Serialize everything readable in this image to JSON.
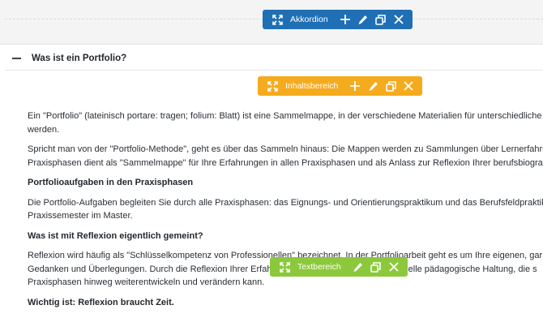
{
  "toolbars": {
    "accordion": {
      "label": "Akkordion",
      "color": "#1f6fb5"
    },
    "content_area": {
      "label": "Inhaltsbereich",
      "color": "#f5ab1e"
    },
    "text_area": {
      "label": "Textbereich",
      "color": "#8cc83c"
    }
  },
  "accordion": {
    "title": "Was ist ein Portfolio?"
  },
  "content": {
    "p1": [
      "Ein \"Portfolio\" (lateinisch portare: tragen; folium: Blatt) ist eine Sammelmappe, in der verschiedene Materialien für unterschiedliche",
      "werden."
    ],
    "p2": [
      "Spricht man von der \"Portfolio-Methode\", geht es über das Sammeln hinaus: Die Mappen werden zu Sammlungen über Lernerfahrun",
      "Praxisphasen dient als \"Sammelmappe\" für Ihre Erfahrungen in allen Praxisphasen und als Anlass zur Reflexion Ihrer berufsbiografis"
    ],
    "h1": "Portfolioaufgaben in den Praxisphasen",
    "p3": [
      "Die Portfolio-Aufgaben begleiten Sie durch alle Praxisphasen: das Eignungs- und Orientierungspraktikum und das Berufsfeldpraktik",
      "Praxissemester im Master."
    ],
    "h2": "Was ist mit Reflexion eigentlich gemeint?",
    "p4": [
      "Reflexion wird häufig als \"Schlüsselkompetenz von Professionellen\" bezeichnet. In der Portfolioarbeit geht es um Ihre eigenen, gar",
      "Gedanken und Überlegungen. Durch die Reflexion Ihrer Erfahrungen können Sie Ihre professionelle pädagogische Haltung, die s",
      "Praxisphasen hinweg weiterentwickeln und verändern kann."
    ],
    "h3": "Wichtig ist: Reflexion braucht Zeit."
  },
  "icons": [
    "expand-icon",
    "plus-icon",
    "pencil-icon",
    "duplicate-icon",
    "close-icon"
  ]
}
